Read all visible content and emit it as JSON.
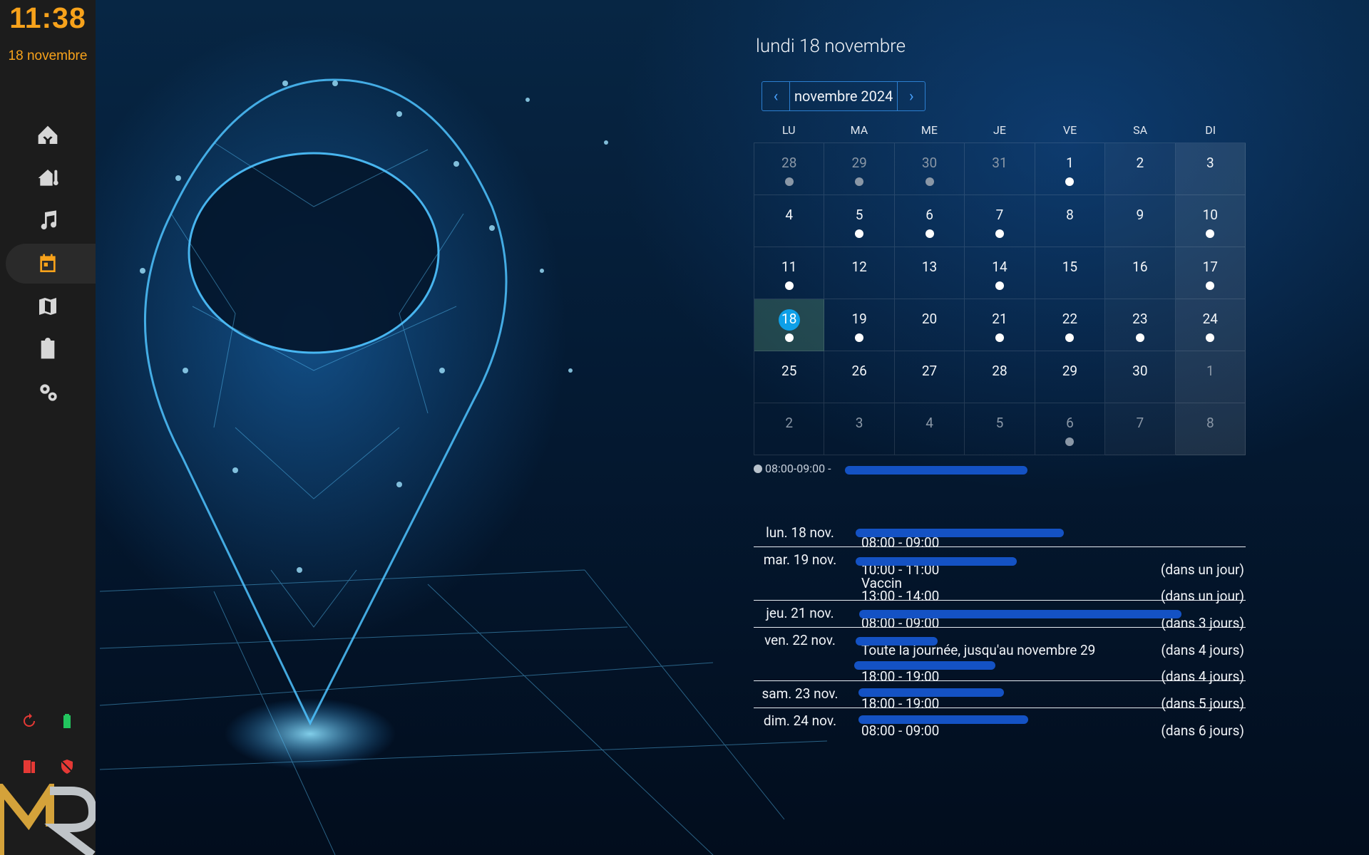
{
  "sidebar": {
    "clock_time": "11:38",
    "clock_date": "18 novembre",
    "nav_items": [
      {
        "icon": "home-assistant-icon",
        "active": false
      },
      {
        "icon": "home-thermometer-icon",
        "active": false
      },
      {
        "icon": "music-icon",
        "active": false
      },
      {
        "icon": "calendar-icon",
        "active": true
      },
      {
        "icon": "map-icon",
        "active": false
      },
      {
        "icon": "clipboard-list-icon",
        "active": false
      },
      {
        "icon": "cogs-icon",
        "active": false
      }
    ],
    "status_icons": [
      "restart-icon",
      "battery-icon",
      "door-open-icon",
      "shield-off-icon"
    ],
    "colors": {
      "accent": "#f7a21b",
      "background": "#1c1c1c",
      "battery": "#22c55e",
      "alert": "#e53935"
    }
  },
  "calendar": {
    "title": "lundi 18 novembre",
    "month_label": "novembre 2024",
    "prev_icon": "chevron-left-icon",
    "next_icon": "chevron-right-icon",
    "weekdays": [
      "LU",
      "MA",
      "ME",
      "JE",
      "VE",
      "SA",
      "DI"
    ],
    "weeks": [
      [
        {
          "d": "28",
          "other": true,
          "dot": true
        },
        {
          "d": "29",
          "other": true,
          "dot": true
        },
        {
          "d": "30",
          "other": true,
          "dot": true
        },
        {
          "d": "31",
          "other": true,
          "dot": false
        },
        {
          "d": "1",
          "dot": true
        },
        {
          "d": "2",
          "dot": false
        },
        {
          "d": "3",
          "dot": false
        }
      ],
      [
        {
          "d": "4",
          "dot": false
        },
        {
          "d": "5",
          "dot": true
        },
        {
          "d": "6",
          "dot": true
        },
        {
          "d": "7",
          "dot": true
        },
        {
          "d": "8",
          "dot": false
        },
        {
          "d": "9",
          "dot": false
        },
        {
          "d": "10",
          "dot": true
        }
      ],
      [
        {
          "d": "11",
          "dot": true
        },
        {
          "d": "12",
          "dot": false
        },
        {
          "d": "13",
          "dot": false
        },
        {
          "d": "14",
          "dot": true
        },
        {
          "d": "15",
          "dot": false
        },
        {
          "d": "16",
          "dot": false
        },
        {
          "d": "17",
          "dot": true
        }
      ],
      [
        {
          "d": "18",
          "dot": true,
          "today": true
        },
        {
          "d": "19",
          "dot": true
        },
        {
          "d": "20",
          "dot": false
        },
        {
          "d": "21",
          "dot": true
        },
        {
          "d": "22",
          "dot": true
        },
        {
          "d": "23",
          "dot": true
        },
        {
          "d": "24",
          "dot": true
        }
      ],
      [
        {
          "d": "25",
          "dot": false
        },
        {
          "d": "26",
          "dot": false
        },
        {
          "d": "27",
          "dot": false
        },
        {
          "d": "28",
          "dot": false
        },
        {
          "d": "29",
          "dot": false
        },
        {
          "d": "30",
          "dot": false
        },
        {
          "d": "1",
          "other": true,
          "dot": false
        }
      ],
      [
        {
          "d": "2",
          "other": true,
          "dot": false
        },
        {
          "d": "3",
          "other": true,
          "dot": false
        },
        {
          "d": "4",
          "other": true,
          "dot": false
        },
        {
          "d": "5",
          "other": true,
          "dot": false
        },
        {
          "d": "6",
          "other": true,
          "dot": true
        },
        {
          "d": "7",
          "other": true,
          "dot": false
        },
        {
          "d": "8",
          "other": true,
          "dot": false
        }
      ]
    ],
    "selected_event_time": "08:00-09:00 -"
  },
  "agenda": [
    {
      "date": "lun. 18 nov.",
      "events": [
        {
          "title": "",
          "time": "08:00 - 09:00",
          "relative": ""
        }
      ]
    },
    {
      "date": "mar. 19 nov.",
      "events": [
        {
          "title": "",
          "time": "10:00 - 11:00",
          "relative": "(dans un jour)"
        },
        {
          "title": "Vaccin",
          "time": "13:00 - 14:00",
          "relative": "(dans un jour)"
        }
      ]
    },
    {
      "date": "jeu. 21 nov.",
      "events": [
        {
          "title": "",
          "time": "08:00 - 09:00",
          "relative": "(dans 3 jours)"
        }
      ]
    },
    {
      "date": "ven. 22 nov.",
      "events": [
        {
          "title": "",
          "time": "Toute la journée, jusqu'au novembre 29",
          "relative": "(dans 4 jours)"
        },
        {
          "title": "",
          "time": "18:00 - 19:00",
          "relative": "(dans 4 jours)"
        }
      ]
    },
    {
      "date": "sam. 23 nov.",
      "events": [
        {
          "title": "",
          "time": "18:00 - 19:00",
          "relative": "(dans 5 jours)"
        }
      ]
    },
    {
      "date": "dim. 24 nov.",
      "events": [
        {
          "title": "",
          "time": "08:00 - 09:00",
          "relative": "(dans 6 jours)"
        }
      ]
    }
  ]
}
